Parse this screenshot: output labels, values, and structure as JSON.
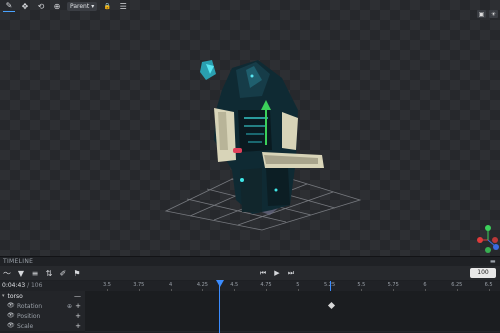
{
  "toolbar": {
    "tools": [
      {
        "name": "rotate-tool-icon",
        "glyph": "✎"
      },
      {
        "name": "move-tool-icon",
        "glyph": "✥"
      },
      {
        "name": "rotate-arrows-icon",
        "glyph": "⟲"
      },
      {
        "name": "pivot-tool-icon",
        "glyph": "⊕"
      }
    ],
    "pivot_select": {
      "value": "Parent",
      "caret": "▾"
    },
    "lock_glyph": "🔒",
    "menu_glyph": "☰"
  },
  "view_toggles": [
    {
      "name": "image-view-icon",
      "glyph": "▣"
    },
    {
      "name": "sun-view-icon",
      "glyph": "☀"
    }
  ],
  "panel": {
    "title": "TIMELINE",
    "collapse_glyph": "▬"
  },
  "timeline": {
    "current_time": "0:04:43",
    "frames": "/ 106",
    "zoom": "100",
    "ruler_ticks": [
      "3.5",
      "3.75",
      "4",
      "4.25",
      "4.5",
      "4.75",
      "5",
      "5.25",
      "5.5",
      "5.75",
      "6",
      "6.25",
      "6.5"
    ],
    "playback": {
      "prev": "⏮",
      "play": "▶",
      "next": "⏭"
    },
    "tools": [
      {
        "name": "graph-editor-icon",
        "glyph": "〜"
      },
      {
        "name": "filter-icon",
        "glyph": "▼"
      },
      {
        "name": "list-icon",
        "glyph": "≡"
      },
      {
        "name": "sort-icon",
        "glyph": "⇅"
      },
      {
        "name": "paint-icon",
        "glyph": "✐"
      },
      {
        "name": "flag-icon",
        "glyph": "⚑"
      }
    ],
    "group": {
      "name": "torso",
      "caret": "▾",
      "collapse": "—"
    },
    "channels": [
      {
        "label": "Rotation",
        "add": "+",
        "extra": "⊕"
      },
      {
        "label": "Position",
        "add": "+",
        "extra": ""
      },
      {
        "label": "Scale",
        "add": "+",
        "extra": ""
      }
    ]
  },
  "colors": {
    "accent": "#3b8cff",
    "axis_x": "#e03b3b",
    "axis_y": "#3bd05a",
    "axis_z": "#3b6be0"
  }
}
